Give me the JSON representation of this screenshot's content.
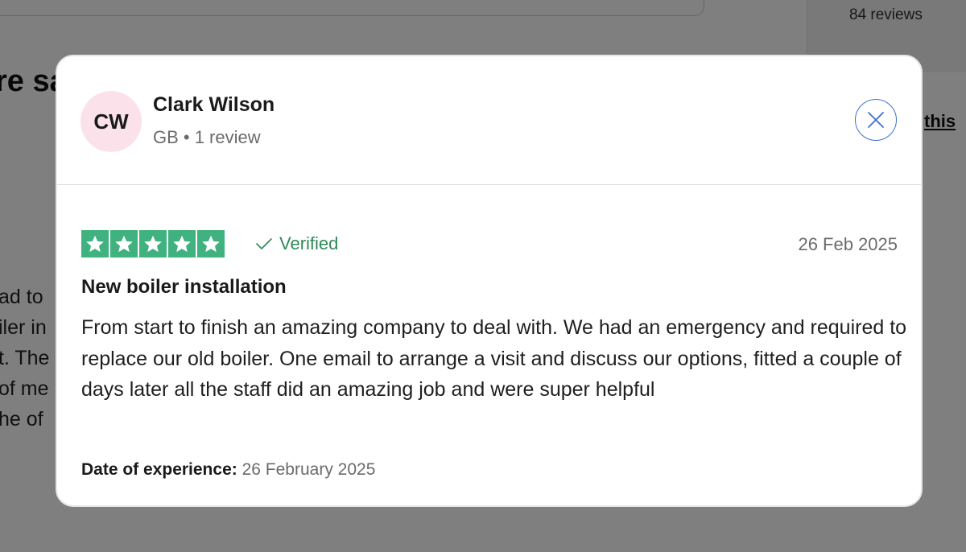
{
  "background": {
    "review_count": "84 reviews",
    "heading_fragment": "re sa",
    "link_fragment": "this",
    "text_fragments": [
      "ad to",
      "iler in",
      "t. The",
      "of me",
      "he of"
    ]
  },
  "reviewer": {
    "initials": "CW",
    "name": "Clark Wilson",
    "meta": "GB • 1 review",
    "avatar_color": "#fbe2ea"
  },
  "close_button": {
    "icon": "close-icon",
    "color": "#3f6fd1"
  },
  "review": {
    "rating": 5,
    "star_color": "#3fb27f",
    "verified_label": "Verified",
    "verified_color": "#2f8a57",
    "date": "26 Feb 2025",
    "title": "New boiler installation",
    "body": "From start to finish an amazing company to deal with. We had an emergency and required to replace our old boiler. One email to arrange a visit and discuss our options, fitted a couple of days later all the staff did an amazing job and were super helpful",
    "experience_label": "Date of experience:",
    "experience_date": "26 February 2025"
  }
}
